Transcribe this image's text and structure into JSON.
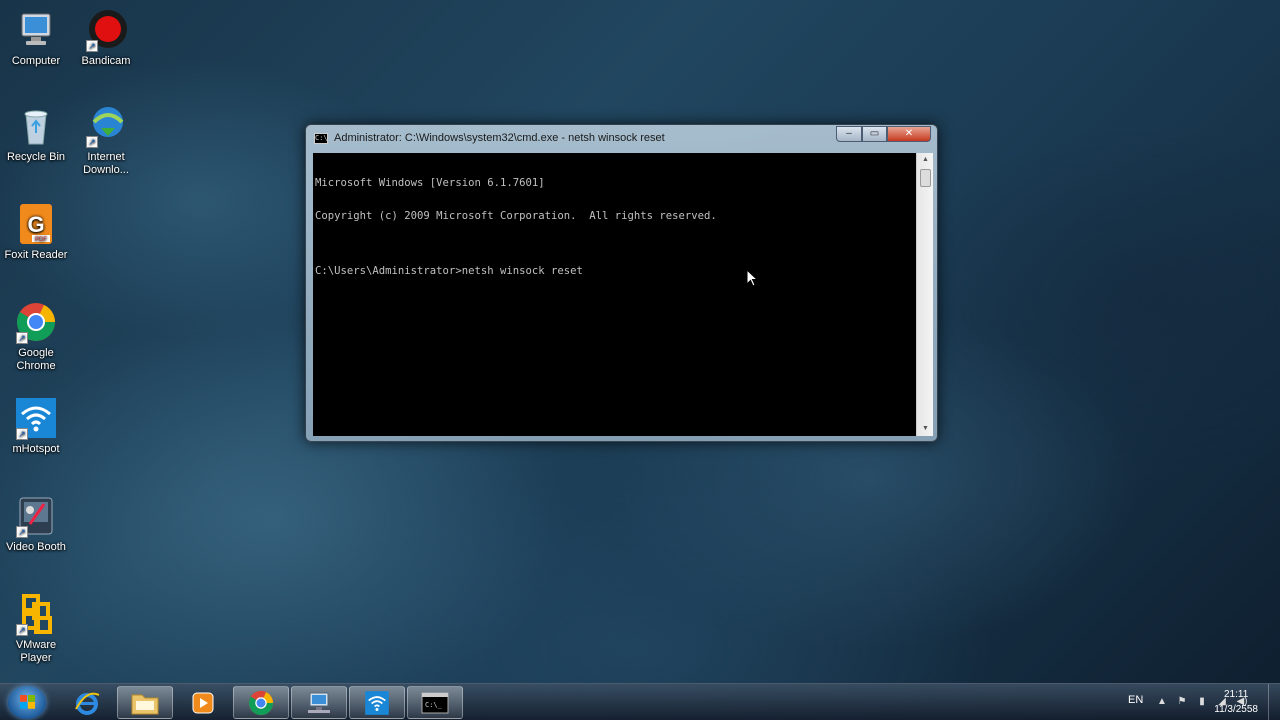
{
  "desktop": {
    "icons": [
      {
        "label": "Computer",
        "icon": "computer-icon"
      },
      {
        "label": "Bandicam",
        "icon": "bandicam-icon"
      },
      {
        "label": "Recycle Bin",
        "icon": "recycle-bin-icon"
      },
      {
        "label": "Internet Downlo...",
        "icon": "internet-download-manager-icon"
      },
      {
        "label": "Foxit Reader",
        "icon": "foxit-reader-icon"
      },
      {
        "label": "Google Chrome",
        "icon": "chrome-icon"
      },
      {
        "label": "mHotspot",
        "icon": "wifi-icon"
      },
      {
        "label": "Video Booth",
        "icon": "video-booth-icon"
      },
      {
        "label": "VMware Player",
        "icon": "vmware-icon"
      }
    ]
  },
  "window": {
    "title": "Administrator: C:\\Windows\\system32\\cmd.exe - netsh  winsock reset",
    "icon_label": "C:\\",
    "buttons": {
      "minimize": "–",
      "maximize": "▭",
      "close": "✕"
    },
    "console_lines": [
      "Microsoft Windows [Version 6.1.7601]",
      "Copyright (c) 2009 Microsoft Corporation.  All rights reserved.",
      "",
      "C:\\Users\\Administrator>netsh winsock reset"
    ]
  },
  "taskbar": {
    "pinned": [
      {
        "name": "internet-explorer",
        "icon": "ie-icon"
      },
      {
        "name": "windows-explorer",
        "icon": "folder-icon"
      },
      {
        "name": "media-player",
        "icon": "media-player-icon"
      },
      {
        "name": "google-chrome",
        "icon": "chrome-icon"
      },
      {
        "name": "network",
        "icon": "network-icon"
      },
      {
        "name": "mhotspot",
        "icon": "wifi-icon"
      },
      {
        "name": "command-prompt",
        "icon": "cmd-icon"
      }
    ],
    "tray": {
      "language": "EN",
      "time": "21:11",
      "date": "11/3/2558"
    }
  }
}
